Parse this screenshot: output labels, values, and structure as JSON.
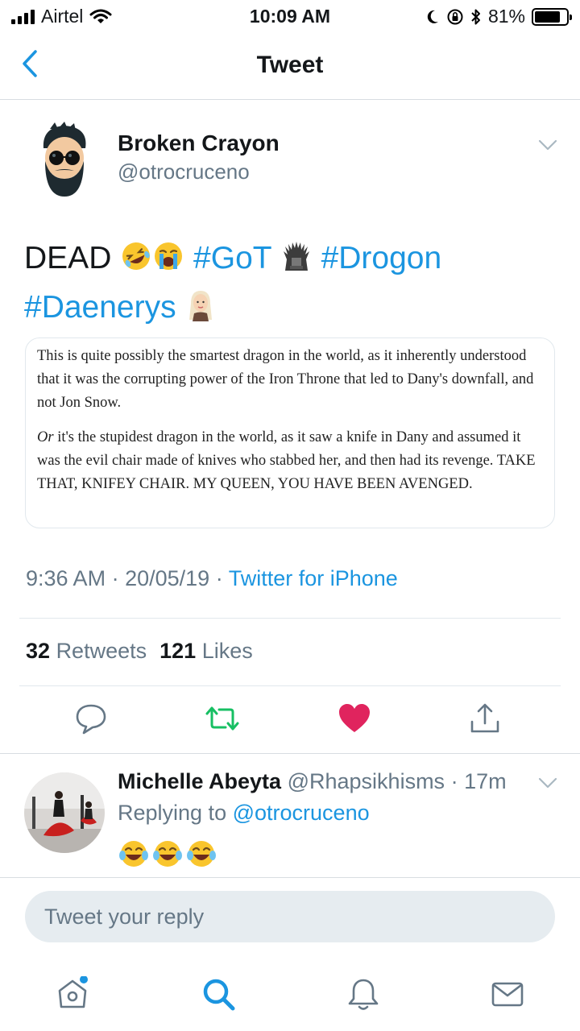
{
  "status_bar": {
    "carrier": "Airtel",
    "time": "10:09 AM",
    "battery_percent": "81%",
    "battery_level": 0.81
  },
  "nav": {
    "title": "Tweet",
    "back_icon": "chevron-left-icon"
  },
  "tweet": {
    "author_name": "Broken Crayon",
    "author_handle": "@otrocruceno",
    "text_dead": "DEAD",
    "hashtag_got": "#GoT",
    "hashtag_drogon": "#Drogon",
    "hashtag_daenerys": "#Daenerys",
    "quote_paragraph_1": "This is quite possibly the smartest dragon in the world, as it inherently understood that it was the corrupting power of the Iron Throne that led to Dany's downfall, and not Jon Snow.",
    "quote_paragraph_2_italic": "Or",
    "quote_paragraph_2": " it's the stupidest dragon in the world, as it saw a knife in Dany and assumed it was the evil chair made of knives who stabbed her, and then had its revenge. TAKE THAT, KNIFEY CHAIR. MY QUEEN, YOU HAVE BEEN AVENGED.",
    "time": "9:36 AM",
    "date": "20/05/19",
    "source": "Twitter for iPhone",
    "retweets_count": "32",
    "retweets_label": "Retweets",
    "likes_count": "121",
    "likes_label": "Likes",
    "liked": true
  },
  "reply": {
    "author_name": "Michelle Abeyta",
    "author_handle": "@Rhapsikhisms",
    "age": "17m",
    "replying_label": "Replying to",
    "replying_to": "@otrocruceno"
  },
  "compose": {
    "placeholder": "Tweet your reply"
  },
  "colors": {
    "accent": "#1b95e0",
    "retweet": "#17bf63",
    "like": "#e0245e",
    "secondary_text": "#657786"
  },
  "tab_bar": [
    "home-icon",
    "search-icon",
    "notifications-icon",
    "messages-icon"
  ]
}
